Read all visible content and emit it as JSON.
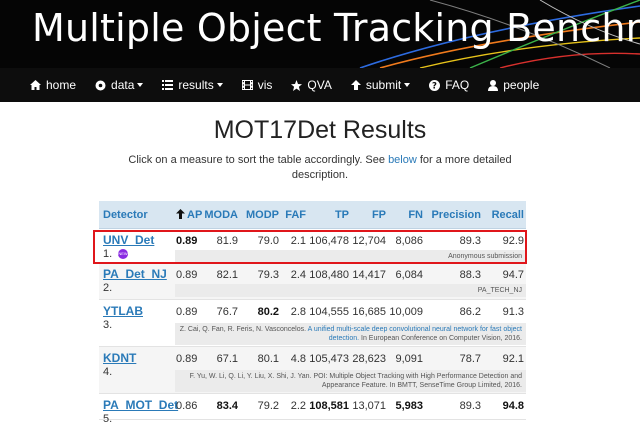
{
  "banner": {
    "title": "Multiple Object Tracking Benchmark"
  },
  "nav": {
    "items": [
      {
        "key": "home",
        "label": "home",
        "icon": "home-icon",
        "dropdown": false
      },
      {
        "key": "data",
        "label": "data",
        "icon": "disc-icon",
        "dropdown": true
      },
      {
        "key": "results",
        "label": "results",
        "icon": "list-icon",
        "dropdown": true
      },
      {
        "key": "vis",
        "label": "vis",
        "icon": "film-icon",
        "dropdown": false
      },
      {
        "key": "qva",
        "label": "QVA",
        "icon": "star-icon",
        "dropdown": false
      },
      {
        "key": "submit",
        "label": "submit",
        "icon": "upload-icon",
        "dropdown": true
      },
      {
        "key": "faq",
        "label": "FAQ",
        "icon": "question-icon",
        "dropdown": false
      },
      {
        "key": "people",
        "label": "people",
        "icon": "user-icon",
        "dropdown": false
      }
    ]
  },
  "page": {
    "title": "MOT17Det Results",
    "intro_before": "Click on a measure to sort the table accordingly. See ",
    "intro_link": "below",
    "intro_after": " for a more detailed description."
  },
  "table": {
    "headers": [
      "Detector",
      "AP",
      "MODA",
      "MODP",
      "FAF",
      "TP",
      "FP",
      "FN",
      "Precision",
      "Recall"
    ],
    "sorted_by": "AP",
    "rows": [
      {
        "name": "UNV_Det",
        "rank": "1.",
        "is_new": true,
        "badge": "NEW",
        "ap": "0.89",
        "moda": "81.9",
        "modp": "79.0",
        "faf": "2.1",
        "tp": "106,478",
        "fp": "12,704",
        "fn": "8,086",
        "precision": "89.3",
        "recall": "92.9",
        "bold": [
          "ap"
        ],
        "ref_plain": "Anonymous submission",
        "ref_link": "",
        "ref_after": ""
      },
      {
        "name": "PA_Det_NJ",
        "rank": "2.",
        "is_new": false,
        "badge": "",
        "ap": "0.89",
        "moda": "82.1",
        "modp": "79.3",
        "faf": "2.4",
        "tp": "108,480",
        "fp": "14,417",
        "fn": "6,084",
        "precision": "88.3",
        "recall": "94.7",
        "bold": [],
        "ref_plain": "PA_TECH_NJ",
        "ref_link": "",
        "ref_after": ""
      },
      {
        "name": "YTLAB",
        "rank": "3.",
        "is_new": false,
        "badge": "",
        "ap": "0.89",
        "moda": "76.7",
        "modp": "80.2",
        "faf": "2.8",
        "tp": "104,555",
        "fp": "16,685",
        "fn": "10,009",
        "precision": "86.2",
        "recall": "91.3",
        "bold": [
          "modp"
        ],
        "ref_plain": "Z. Cai, Q. Fan, R. Feris, N. Vasconcelos. ",
        "ref_link": "A unified multi-scale deep convolutional neural network for fast object detection.",
        "ref_after": " In European Conference on Computer Vision, 2016."
      },
      {
        "name": "KDNT",
        "rank": "4.",
        "is_new": false,
        "badge": "",
        "ap": "0.89",
        "moda": "67.1",
        "modp": "80.1",
        "faf": "4.8",
        "tp": "105,473",
        "fp": "28,623",
        "fn": "9,091",
        "precision": "78.7",
        "recall": "92.1",
        "bold": [],
        "ref_plain": "F. Yu, W. Li, Q. Li, Y. Liu, X. Shi, J. Yan. POI: Multiple Object Tracking with High Performance Detection and Appearance Feature. In BMTT, SenseTime Group Limited, 2016.",
        "ref_link": "",
        "ref_after": ""
      },
      {
        "name": "PA_MOT_Det",
        "rank": "5.",
        "is_new": false,
        "badge": "",
        "ap": "0.86",
        "moda": "83.4",
        "modp": "79.2",
        "faf": "2.2",
        "tp": "108,581",
        "fp": "13,071",
        "fn": "5,983",
        "precision": "89.3",
        "recall": "94.8",
        "bold": [
          "moda",
          "tp",
          "fn",
          "recall"
        ],
        "ref_plain": "",
        "ref_link": "",
        "ref_after": ""
      }
    ]
  },
  "colors": {
    "link": "#2a7ab8",
    "header_bg": "#d8e6f1",
    "highlight": "#e0161b",
    "new_badge": "#8a2be2"
  }
}
